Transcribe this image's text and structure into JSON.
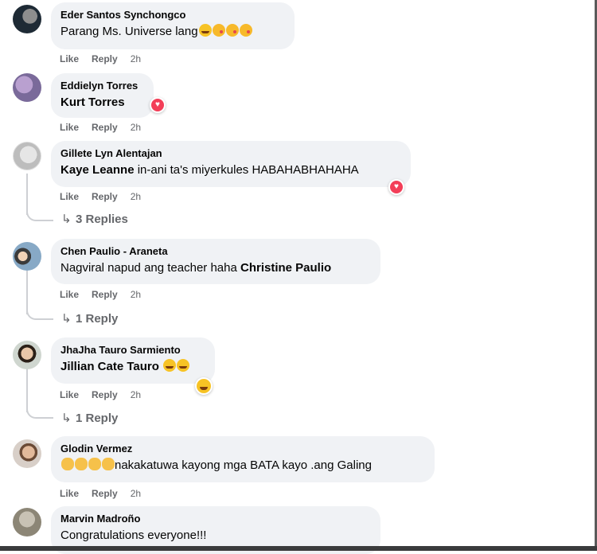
{
  "colors": {
    "bubble": "#f0f2f5",
    "meta": "#65676b",
    "heart": "#f33e58",
    "haha": "#f7c325"
  },
  "comments": [
    {
      "author": "Eder Santos Synchongco",
      "text": "Parang Ms. Universe lang",
      "emoji": [
        "laugh-cry",
        "kiss",
        "kiss",
        "kiss"
      ],
      "like": "Like",
      "reply": "Reply",
      "time": "2h"
    },
    {
      "author": "Eddielyn Torres",
      "mention": "Kurt Torres",
      "reaction": "heart",
      "like": "Like",
      "reply": "Reply",
      "time": "2h"
    },
    {
      "author": "Gillete Lyn Alentajan",
      "mention": "Kaye Leanne",
      "text": " in-ani ta's miyerkules HABAHABHAHAHA",
      "reaction": "heart",
      "like": "Like",
      "reply": "Reply",
      "time": "2h",
      "replies": "3 Replies"
    },
    {
      "author": "Chen Paulio - Araneta",
      "text": "Nagviral napud ang teacher haha ",
      "mention": "Christine Paulio",
      "like": "Like",
      "reply": "Reply",
      "time": "2h",
      "replies": "1 Reply"
    },
    {
      "author": "JhaJha Tauro Sarmiento",
      "mention": "Jillian Cate Tauro",
      "emoji": [
        "grin-sweat",
        "laugh-cry"
      ],
      "reaction": "haha",
      "like": "Like",
      "reply": "Reply",
      "time": "2h",
      "replies": "1 Reply"
    },
    {
      "author": "Glodin Vermez",
      "emoji": [
        "clap",
        "clap",
        "clap",
        "clap"
      ],
      "text": "nakakatuwa kayong mga BATA kayo .ang Galing",
      "like": "Like",
      "reply": "Reply",
      "time": "2h"
    },
    {
      "author": "Marvin Madroño",
      "text": "Congratulations everyone!!!"
    }
  ]
}
